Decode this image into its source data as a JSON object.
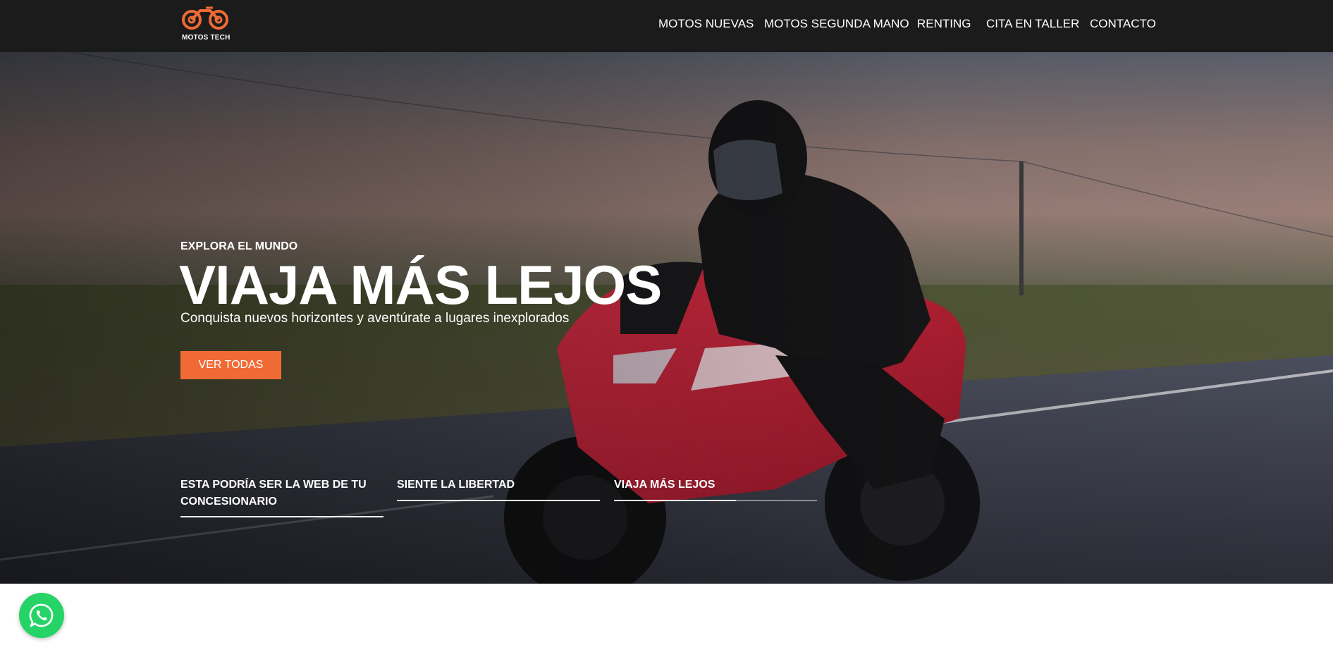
{
  "brand": {
    "name": "MOTOS TECH",
    "accent_color": "#f06a35",
    "header_bg": "#1b1b1b"
  },
  "nav": {
    "items": [
      {
        "label": "MOTOS NUEVAS"
      },
      {
        "label": "MOTOS SEGUNDA MANO"
      },
      {
        "label": "RENTING"
      },
      {
        "label": "CITA EN TALLER"
      },
      {
        "label": "CONTACTO"
      }
    ]
  },
  "hero": {
    "eyebrow": "EXPLORA EL MUNDO",
    "title": "VIAJA MÁS LEJOS",
    "subtitle": "Conquista nuevos horizontes y aventúrate a lugares inexplorados",
    "cta_label": "VER TODAS",
    "slides": [
      {
        "label": "ESTA PODRÍA SER LA WEB DE TU CONCESIONARIO",
        "progress": 1.0
      },
      {
        "label": "SIENTE LA LIBERTAD",
        "progress": 1.0
      },
      {
        "label": "VIAJA MÁS LEJOS",
        "progress": 0.6
      }
    ]
  },
  "whatsapp": {
    "icon": "whatsapp-icon",
    "color": "#25d366"
  }
}
